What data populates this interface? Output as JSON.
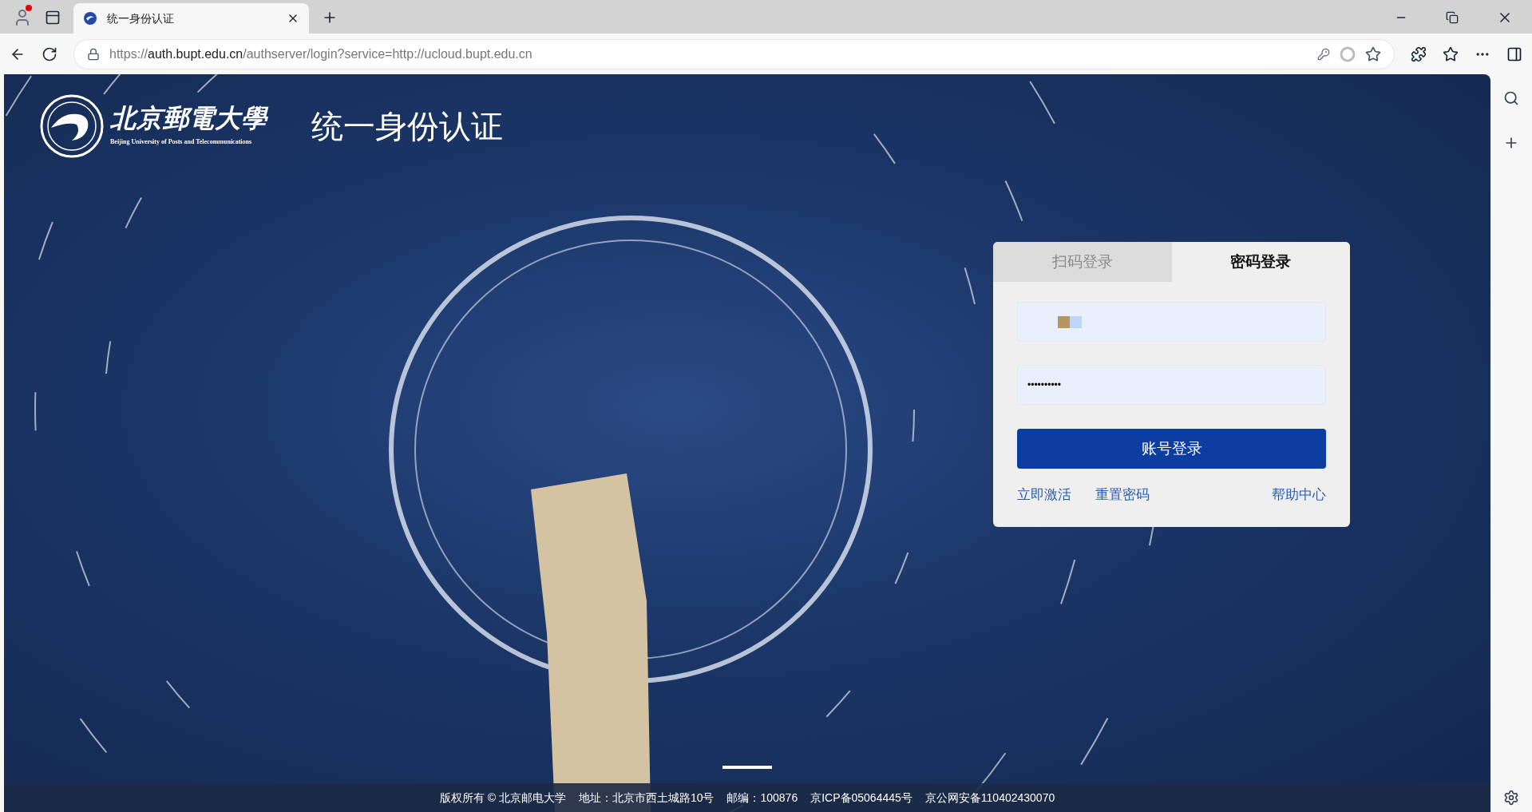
{
  "browser": {
    "tab_title": "统一身份认证",
    "url": {
      "scheme": "https://",
      "host": "auth.bupt.edu.cn",
      "path": "/authserver/login?service=http://ucloud.bupt.edu.cn"
    }
  },
  "header": {
    "logo_cn": "北京郵電大學",
    "logo_en": "Beijing University of Posts and Telecommunications",
    "title": "统一身份认证"
  },
  "login": {
    "tabs": [
      {
        "label": "扫码登录",
        "selected": false
      },
      {
        "label": "密码登录",
        "selected": true
      }
    ],
    "password": {
      "value": "••••••••••"
    },
    "submit": "账号登录",
    "links": [
      "立即激活",
      "重置密码",
      "帮助中心"
    ]
  },
  "footer": [
    "版权所有 © 北京邮电大学",
    "地址：北京市西土城路10号",
    "邮编：100876",
    "京ICP备05064445号",
    "京公网安备110402430070"
  ]
}
